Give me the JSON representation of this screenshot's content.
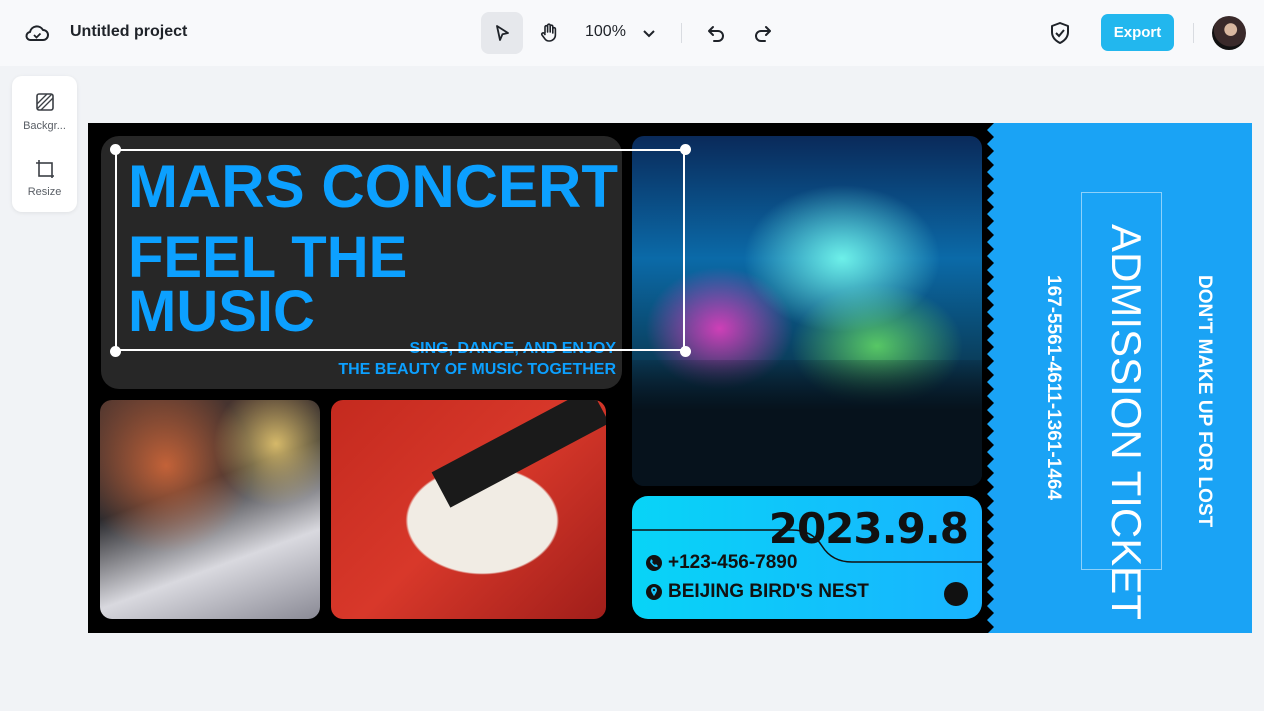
{
  "header": {
    "project_title": "Untitled project",
    "zoom": "100%",
    "export_label": "Export"
  },
  "sidebar": {
    "items": [
      {
        "label": "Backgr...",
        "icon": "background-icon"
      },
      {
        "label": "Resize",
        "icon": "resize-icon"
      }
    ]
  },
  "design": {
    "headline_1": "MARS CONCERT",
    "headline_2": "FEEL THE",
    "headline_3": "MUSIC",
    "tagline_1": "SING, DANCE, AND ENJOY",
    "tagline_2": "THE BEAUTY OF MUSIC TOGETHER",
    "date": "2023.9.8",
    "phone": "+123-456-7890",
    "venue": "BEIJING BIRD'S NEST",
    "ticket_number": "167-5561-4611-1361-1464",
    "ticket_title": "ADMISSION TICKET",
    "ticket_slogan": "DON'T MAKE UP FOR LOST",
    "accent_color": "#0ca0ff",
    "ticket_color": "#1aa3f5"
  }
}
